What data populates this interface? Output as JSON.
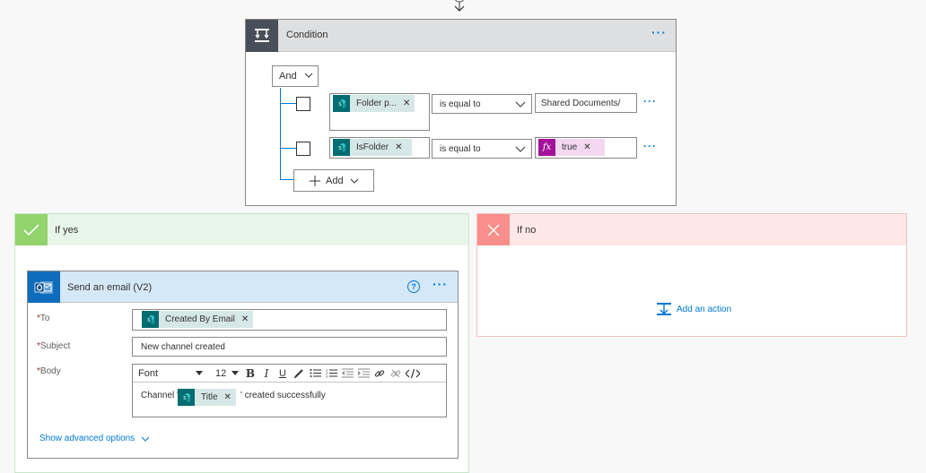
{
  "condition": {
    "title": "Condition",
    "more_label": "···",
    "group_operator": "And",
    "rows": [
      {
        "left_token": "Folder p...",
        "operator": "is equal to",
        "value": "Shared Documents/"
      },
      {
        "left_token": "IsFolder",
        "operator": "is equal to",
        "value_token": "true"
      }
    ],
    "add_label": "Add"
  },
  "if_yes": {
    "title": "If yes",
    "action": {
      "title": "Send an email (V2)",
      "help_label": "?",
      "fields": {
        "to": {
          "label": "To",
          "token": "Created By Email"
        },
        "subject": {
          "label": "Subject",
          "value": "New channel created"
        },
        "body": {
          "label": "Body",
          "font": "Font",
          "size": "12",
          "text_before": "Channel '",
          "token": "Title",
          "text_after": "' created successfully"
        }
      },
      "advanced_label": "Show advanced options"
    }
  },
  "if_no": {
    "title": "If no",
    "add_action_label": "Add an action"
  },
  "colors": {
    "accent": "#0078d4",
    "sharepoint_teal": "#036c70",
    "yes_green": "#92d36e",
    "no_red": "#f88f8a"
  }
}
